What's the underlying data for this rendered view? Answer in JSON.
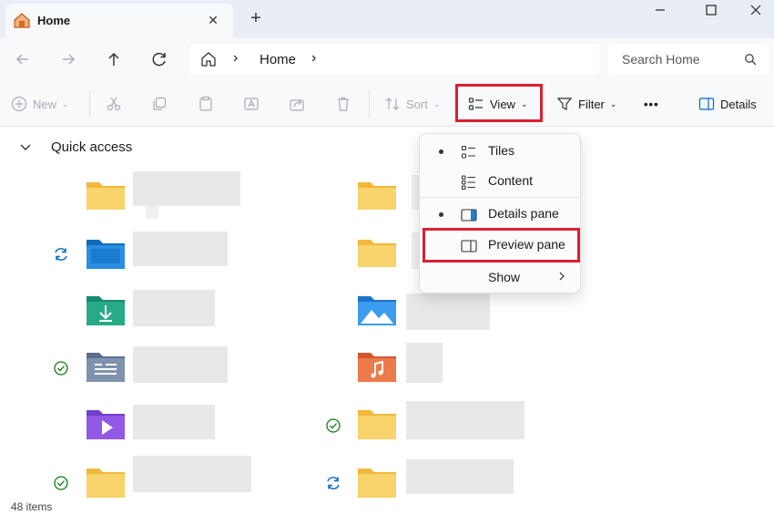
{
  "tab": {
    "title": "Home",
    "close": "✕"
  },
  "window": {
    "new_tab": "+"
  },
  "address": {
    "crumb": "Home",
    "sep1": "›",
    "sep2": "›"
  },
  "search": {
    "placeholder": "Search Home"
  },
  "toolbar": {
    "new_label": "New",
    "sort_label": "Sort",
    "view_label": "View",
    "filter_label": "Filter",
    "more_label": "•••",
    "details_label": "Details"
  },
  "content": {
    "section_title": "Quick access"
  },
  "view_menu": {
    "items": [
      {
        "label": "Tiles",
        "selected": true
      },
      {
        "label": "Content",
        "selected": false
      },
      {
        "label": "Details pane",
        "selected": true
      },
      {
        "label": "Preview pane",
        "selected": false
      },
      {
        "label": "Show",
        "selected": false
      }
    ]
  },
  "status": {
    "item_count": "48 items"
  },
  "colors": {
    "highlight": "#d92030",
    "folder": "#f7c948",
    "accent": "#0067c0",
    "check": "#107c10"
  }
}
